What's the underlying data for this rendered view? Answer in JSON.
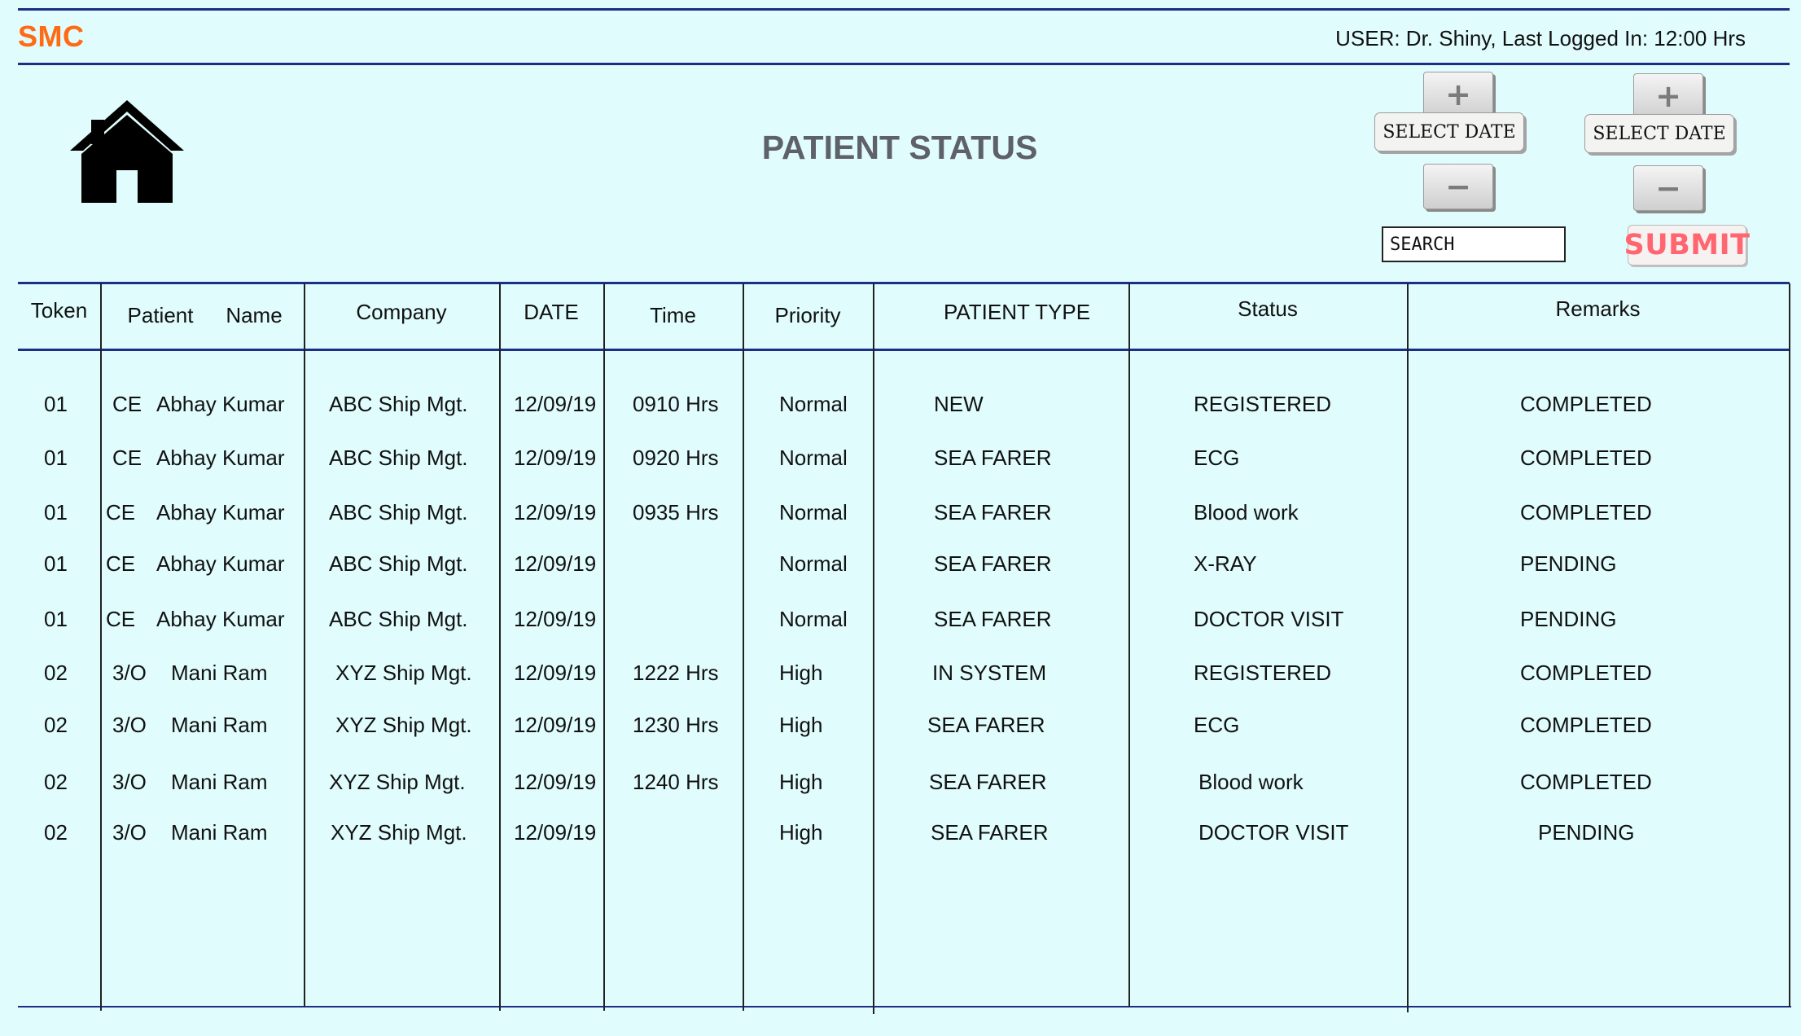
{
  "header": {
    "brand": "SMC",
    "user_info": "USER: Dr. Shiny, Last Logged In: 12:00 Hrs",
    "home_icon": "home-icon",
    "page_title": "PATIENT STATUS"
  },
  "controls": {
    "date_pickers": [
      {
        "label": "SELECT DATE",
        "increment_icon": "plus-icon",
        "decrement_icon": "minus-icon"
      },
      {
        "label": "SELECT DATE",
        "increment_icon": "plus-icon",
        "decrement_icon": "minus-icon"
      }
    ],
    "search": {
      "placeholder": "SEARCH",
      "value": ""
    },
    "submit_label": "SUBMIT"
  },
  "colors": {
    "background": "#e0fcfc",
    "brand": "#ff6a14",
    "rule": "#1b2f86",
    "title": "#5e6268",
    "submit_text": "#ff6670"
  },
  "table": {
    "headers": {
      "token": "Token",
      "patient": "Patient",
      "name": "Name",
      "company": "Company",
      "date": "DATE",
      "time": "Time",
      "priority": "Priority",
      "patient_type": "PATIENT TYPE",
      "status": "Status",
      "remarks": "Remarks"
    },
    "rows": [
      {
        "token": "01",
        "rank": "CE",
        "name": "Abhay Kumar",
        "company": "ABC Ship Mgt.",
        "date": "12/09/19",
        "time": "0910 Hrs",
        "priority": "Normal",
        "patient_type": "NEW",
        "status": "REGISTERED",
        "remarks": "COMPLETED"
      },
      {
        "token": "01",
        "rank": "CE",
        "name": "Abhay Kumar",
        "company": "ABC Ship Mgt.",
        "date": "12/09/19",
        "time": "0920 Hrs",
        "priority": "Normal",
        "patient_type": "SEA FARER",
        "status": "ECG",
        "remarks": "COMPLETED"
      },
      {
        "token": "01",
        "rank": "CE",
        "name": "Abhay Kumar",
        "company": "ABC Ship Mgt.",
        "date": "12/09/19",
        "time": "0935 Hrs",
        "priority": "Normal",
        "patient_type": "SEA FARER",
        "status": "Blood work",
        "remarks": "COMPLETED"
      },
      {
        "token": "01",
        "rank": "CE",
        "name": "Abhay Kumar",
        "company": "ABC Ship Mgt.",
        "date": "12/09/19",
        "time": "",
        "priority": "Normal",
        "patient_type": "SEA FARER",
        "status": "X-RAY",
        "remarks": "PENDING"
      },
      {
        "token": "01",
        "rank": "CE",
        "name": "Abhay Kumar",
        "company": "ABC Ship Mgt.",
        "date": "12/09/19",
        "time": "",
        "priority": "Normal",
        "patient_type": "SEA FARER",
        "status": "DOCTOR VISIT",
        "remarks": "PENDING"
      },
      {
        "token": "02",
        "rank": "3/O",
        "name": "Mani Ram",
        "company": "XYZ Ship Mgt.",
        "date": "12/09/19",
        "time": "1222 Hrs",
        "priority": "High",
        "patient_type": "IN SYSTEM",
        "status": "REGISTERED",
        "remarks": "COMPLETED"
      },
      {
        "token": "02",
        "rank": "3/O",
        "name": "Mani Ram",
        "company": "XYZ Ship Mgt.",
        "date": "12/09/19",
        "time": "1230 Hrs",
        "priority": "High",
        "patient_type": "SEA FARER",
        "status": "ECG",
        "remarks": "COMPLETED"
      },
      {
        "token": "02",
        "rank": "3/O",
        "name": "Mani Ram",
        "company": "XYZ Ship Mgt.",
        "date": "12/09/19",
        "time": "1240 Hrs",
        "priority": "High",
        "patient_type": "SEA FARER",
        "status": "Blood work",
        "remarks": "COMPLETED"
      },
      {
        "token": "02",
        "rank": "3/O",
        "name": "Mani Ram",
        "company": "XYZ Ship Mgt.",
        "date": "12/09/19",
        "time": "",
        "priority": "High",
        "patient_type": "SEA FARER",
        "status": "DOCTOR VISIT",
        "remarks": "PENDING"
      }
    ]
  }
}
